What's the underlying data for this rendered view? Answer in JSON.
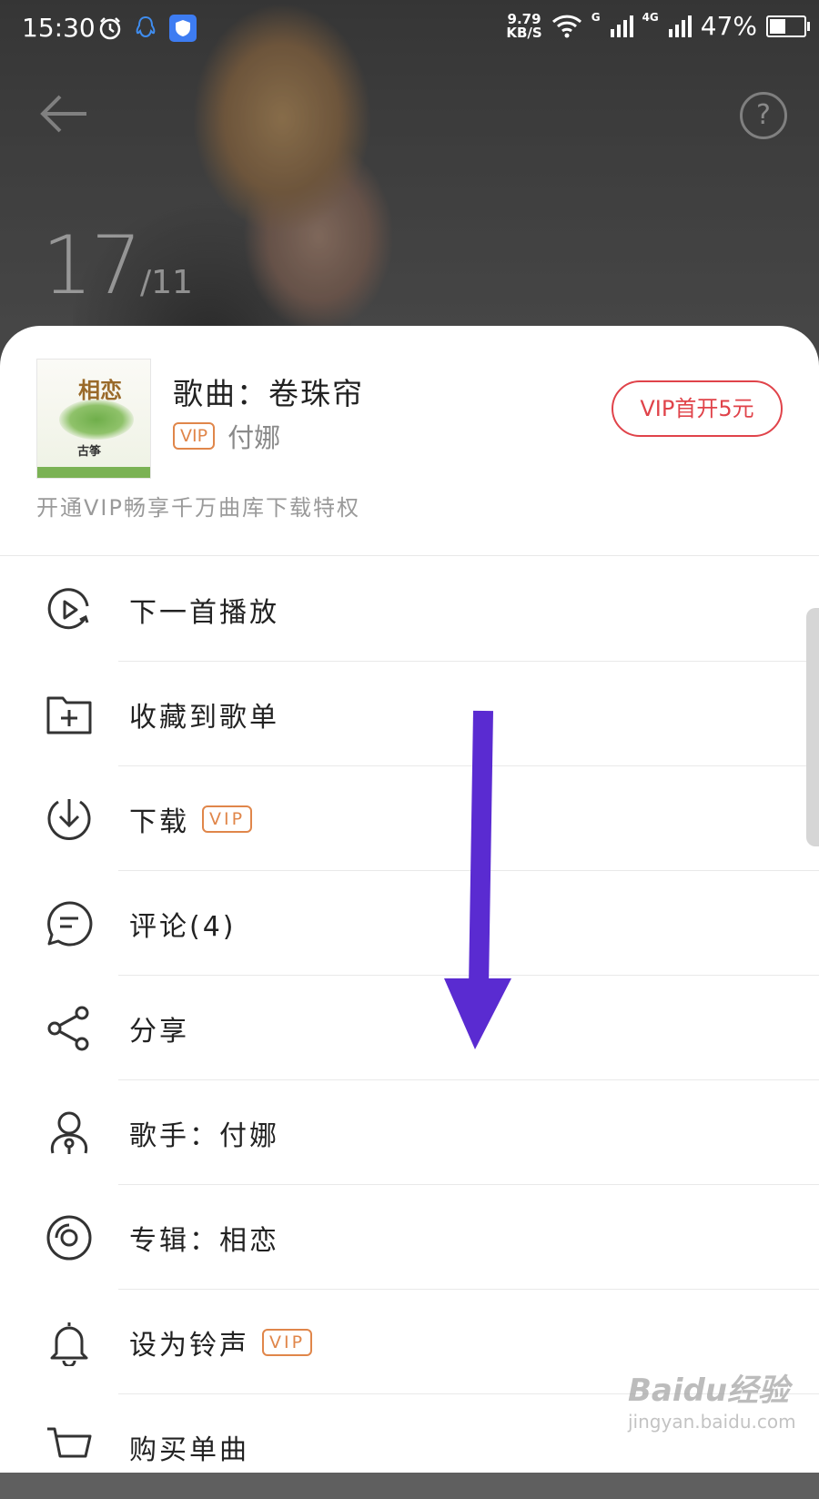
{
  "status_bar": {
    "time": "15:30",
    "net_speed_value": "9.79",
    "net_speed_unit": "KB/S",
    "signal_label": "G",
    "signal2_label": "4G",
    "battery": "47%",
    "battery_level": 0.47,
    "icons": [
      "alarm-icon",
      "qq-icon",
      "shield-icon",
      "wifi-icon",
      "signal-icon"
    ]
  },
  "header": {
    "back_icon": "arrow-left-icon",
    "help_icon": "question-icon",
    "help_glyph": "?",
    "page_current": "17",
    "page_total": "/11"
  },
  "song": {
    "title": "歌曲：卷珠帘",
    "vip_badge": "VIP",
    "artist": "付娜",
    "cover_title": "相恋",
    "cover_sub": "古筝",
    "vip_button": "VIP首开5元",
    "vip_promo": "开通VIP畅享千万曲库下载特权"
  },
  "menu": [
    {
      "label": "下一首播放",
      "icon": "play-next-icon",
      "vip": ""
    },
    {
      "label": "收藏到歌单",
      "icon": "add-folder-icon",
      "vip": ""
    },
    {
      "label": "下载",
      "icon": "download-icon",
      "vip": "VIP"
    },
    {
      "label": "评论(4)",
      "icon": "comment-icon",
      "vip": ""
    },
    {
      "label": "分享",
      "icon": "share-icon",
      "vip": ""
    },
    {
      "label": "歌手：付娜",
      "icon": "singer-icon",
      "vip": ""
    },
    {
      "label": "专辑：相恋",
      "icon": "album-icon",
      "vip": ""
    },
    {
      "label": "设为铃声",
      "icon": "bell-icon",
      "vip": "VIP"
    },
    {
      "label": "购买单曲",
      "icon": "cart-icon",
      "vip": ""
    }
  ],
  "watermark": {
    "brand": "Baidu经验",
    "url": "jingyan.baidu.com"
  },
  "colors": {
    "accent_red": "#e0434a",
    "vip_orange": "#e0864a",
    "annotation_arrow": "#5a2bd1"
  }
}
